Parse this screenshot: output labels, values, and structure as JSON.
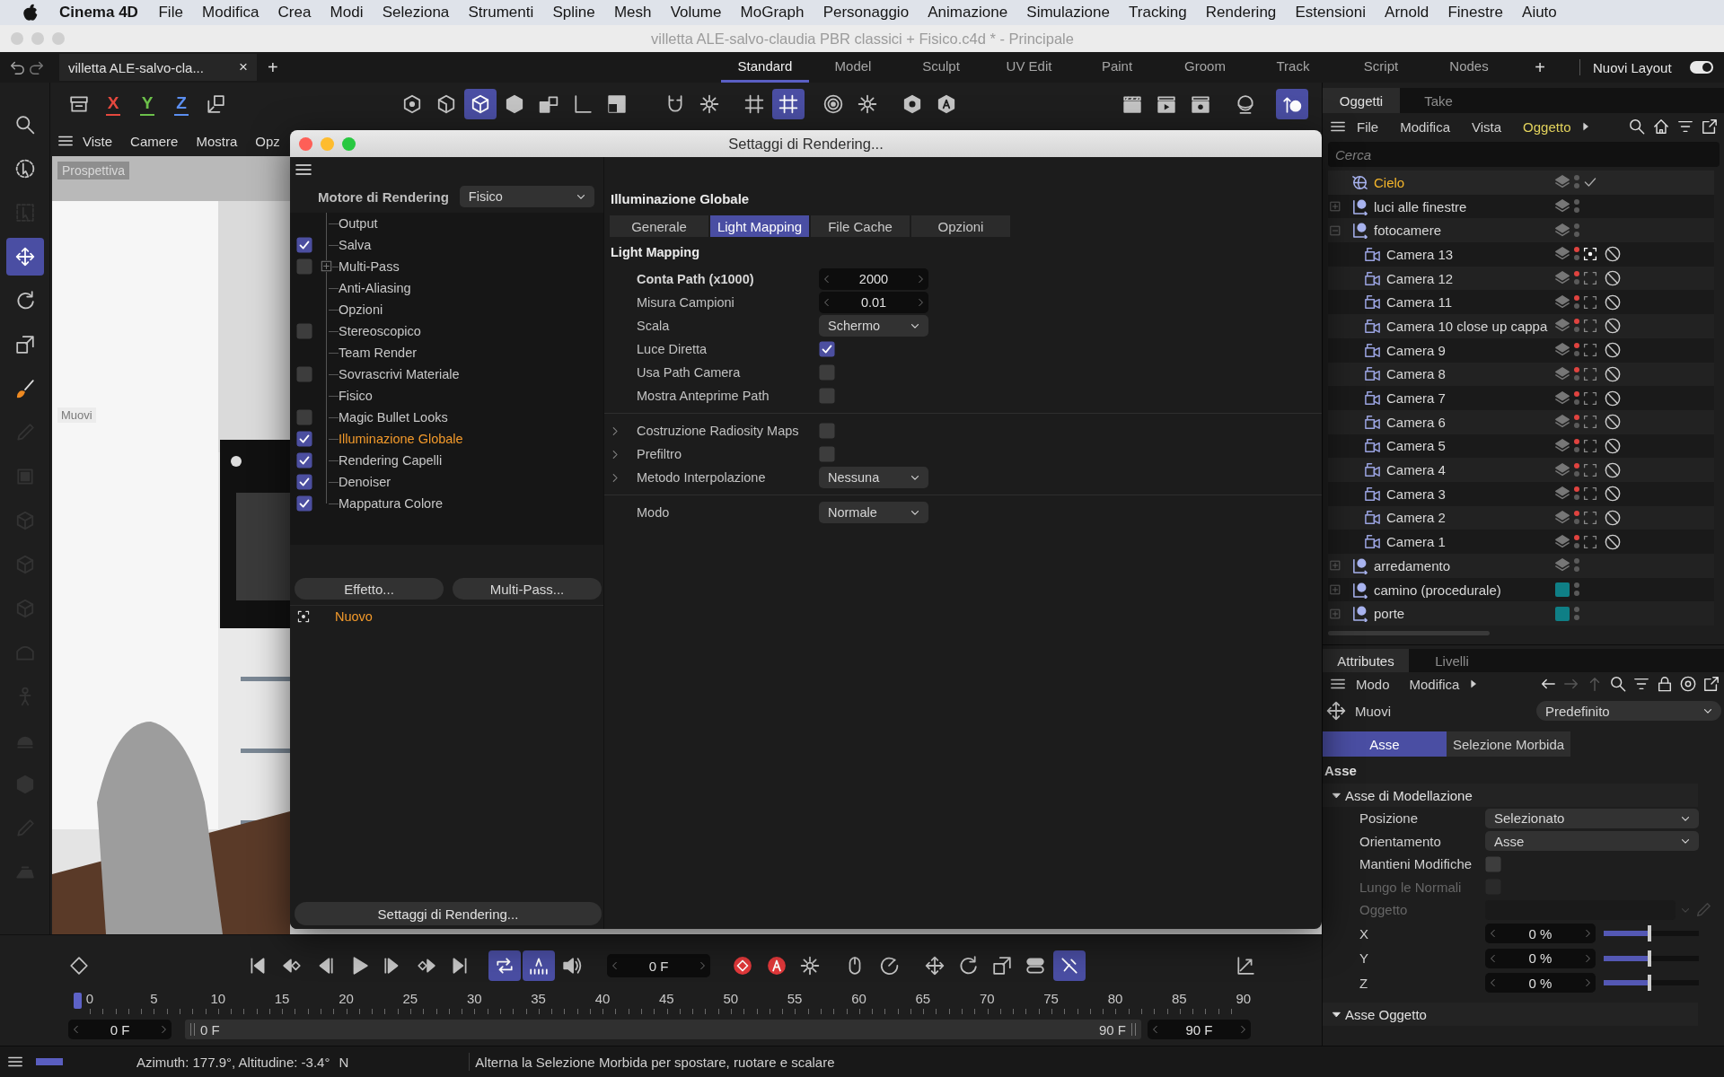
{
  "menu_bar": {
    "app": "Cinema 4D",
    "items": [
      "File",
      "Modifica",
      "Crea",
      "Modi",
      "Seleziona",
      "Strumenti",
      "Spline",
      "Mesh",
      "Volume",
      "MoGraph",
      "Personaggio",
      "Animazione",
      "Simulazione",
      "Tracking",
      "Rendering",
      "Estensioni",
      "Arnold",
      "Finestre",
      "Aiuto"
    ]
  },
  "window": {
    "title": "villetta ALE-salvo-claudia PBR classici + Fisico.c4d * - Principale"
  },
  "document_tab": {
    "title": "villetta ALE-salvo-cla...",
    "close": "×",
    "add": "+"
  },
  "layouts": [
    {
      "label": "Standard",
      "selected": true
    },
    {
      "label": "Model",
      "selected": false
    },
    {
      "label": "Sculpt",
      "selected": false
    },
    {
      "label": "UV Edit",
      "selected": false
    },
    {
      "label": "Paint",
      "selected": false
    },
    {
      "label": "Groom",
      "selected": false
    },
    {
      "label": "Track",
      "selected": false
    },
    {
      "label": "Script",
      "selected": false
    },
    {
      "label": "Nodes",
      "selected": false
    }
  ],
  "layout_add": "+",
  "layout_switch": {
    "label": "Nuovi Layout",
    "on": true
  },
  "toolbar": [
    [
      {
        "kind": "tray",
        "active": false
      },
      {
        "kind": "axis",
        "label": "X",
        "color": "#e5483e",
        "active": false
      },
      {
        "kind": "axis",
        "label": "Y",
        "color": "#6cc04a",
        "active": false
      },
      {
        "kind": "axis",
        "label": "Z",
        "color": "#5b8ef0",
        "active": false
      },
      {
        "kind": "axisbox",
        "active": false
      }
    ],
    [
      {
        "kind": "hexdot",
        "active": false
      },
      {
        "kind": "hexedge",
        "active": false
      },
      {
        "kind": "cube",
        "active": true
      },
      {
        "kind": "cubesolid",
        "active": false
      },
      {
        "kind": "cubes",
        "active": false
      },
      {
        "kind": "corner",
        "active": false
      },
      {
        "kind": "halfsquare",
        "active": false
      }
    ],
    [
      {
        "kind": "magnet",
        "active": false
      },
      {
        "kind": "gear",
        "active": false
      }
    ],
    [
      {
        "kind": "grid",
        "active": false
      },
      {
        "kind": "grid",
        "active": true
      }
    ],
    [
      {
        "kind": "rings",
        "active": false
      },
      {
        "kind": "gear",
        "active": false
      }
    ],
    [
      {
        "kind": "hexring",
        "active": false
      },
      {
        "kind": "hexa",
        "active": false
      }
    ],
    [
      {
        "kind": "clapper",
        "active": false
      },
      {
        "kind": "clapperplay",
        "active": false
      },
      {
        "kind": "clappergear",
        "active": false
      }
    ],
    [
      {
        "kind": "sphere",
        "active": false
      }
    ],
    [
      {
        "kind": "pin",
        "active": true
      }
    ]
  ],
  "tools": [
    {
      "kind": "search",
      "active": false,
      "disabled": false
    },
    {
      "kind": "select",
      "active": false,
      "disabled": false
    },
    {
      "kind": "boxselect",
      "active": false,
      "disabled": true
    },
    {
      "kind": "move",
      "active": true,
      "disabled": false
    },
    {
      "kind": "rotate",
      "active": false,
      "disabled": false
    },
    {
      "kind": "scale",
      "active": false,
      "disabled": false
    },
    {
      "kind": "brush",
      "active": false,
      "disabled": false
    },
    {
      "kind": "pen",
      "active": false,
      "disabled": true
    },
    {
      "kind": "square",
      "active": false,
      "disabled": true
    },
    {
      "kind": "cube",
      "active": false,
      "disabled": true
    },
    {
      "kind": "cube",
      "active": false,
      "disabled": true
    },
    {
      "kind": "cube",
      "active": false,
      "disabled": true
    },
    {
      "kind": "arc",
      "active": false,
      "disabled": true
    },
    {
      "kind": "figure",
      "active": false,
      "disabled": true
    },
    {
      "kind": "helmet",
      "active": false,
      "disabled": true
    },
    {
      "kind": "cubesolid",
      "active": false,
      "disabled": true
    },
    {
      "kind": "pen",
      "active": false,
      "disabled": true
    },
    {
      "kind": "iron",
      "active": false,
      "disabled": true
    }
  ],
  "viewport": {
    "menu": [
      "Viste",
      "Camere",
      "Mostra",
      "Opz"
    ],
    "camera": "Prospettiva",
    "tool_hint": "Muovi"
  },
  "render_settings": {
    "title": "Settaggi di Rendering...",
    "renderer_label": "Motore di Rendering",
    "renderer": "Fisico",
    "pages": [
      {
        "label": "Output",
        "kind": "plain",
        "selected": false
      },
      {
        "label": "Salva",
        "kind": "checkbox",
        "checked": true,
        "selected": false
      },
      {
        "label": "Multi-Pass",
        "kind": "checkbox",
        "checked": false,
        "expanded": false,
        "selected": false
      },
      {
        "label": "Anti-Aliasing",
        "kind": "plain",
        "selected": false
      },
      {
        "label": "Opzioni",
        "kind": "plain",
        "selected": false
      },
      {
        "label": "Stereoscopico",
        "kind": "checkbox",
        "checked": false,
        "selected": false
      },
      {
        "label": "Team Render",
        "kind": "plain",
        "selected": false
      },
      {
        "label": "Sovrascrivi Materiale",
        "kind": "checkbox",
        "checked": false,
        "selected": false
      },
      {
        "label": "Fisico",
        "kind": "plain",
        "selected": false
      },
      {
        "label": "Magic Bullet Looks",
        "kind": "checkbox",
        "checked": false,
        "selected": false
      },
      {
        "label": "Illuminazione Globale",
        "kind": "checkbox",
        "checked": true,
        "selected": true
      },
      {
        "label": "Rendering Capelli",
        "kind": "checkbox",
        "checked": true,
        "selected": false
      },
      {
        "label": "Denoiser",
        "kind": "checkbox",
        "checked": true,
        "selected": false
      },
      {
        "label": "Mappatura Colore",
        "kind": "checkbox",
        "checked": true,
        "selected": false
      }
    ],
    "buttons": [
      "Effetto...",
      "Multi-Pass..."
    ],
    "presets": [
      {
        "label": "Nuovo",
        "selected": true
      }
    ],
    "preset_button": "Settaggi di Rendering...",
    "panel": {
      "title": "Illuminazione Globale",
      "tabs": [
        {
          "label": "Generale",
          "selected": false
        },
        {
          "label": "Light Mapping",
          "selected": true
        },
        {
          "label": "File Cache",
          "selected": false
        },
        {
          "label": "Opzioni",
          "selected": false
        }
      ],
      "section": "Light Mapping",
      "groups": [
        [
          {
            "label": "Conta Path (x1000)",
            "kind": "number",
            "value": "2000",
            "modified": true
          },
          {
            "label": "Misura Campioni",
            "kind": "number",
            "value": "0.01",
            "modified": false
          },
          {
            "label": "Scala",
            "kind": "dropdown",
            "value": "Schermo",
            "modified": false
          },
          {
            "label": "Luce Diretta",
            "kind": "checkbox",
            "checked": true,
            "modified": false
          },
          {
            "label": "Usa Path Camera",
            "kind": "checkbox",
            "checked": false,
            "modified": false
          },
          {
            "label": "Mostra Anteprime Path",
            "kind": "checkbox",
            "checked": false,
            "modified": false
          }
        ],
        [
          {
            "label": "Costruzione Radiosity Maps",
            "kind": "checkbox",
            "checked": false,
            "expanded": false,
            "modified": false
          },
          {
            "label": "Prefiltro",
            "kind": "checkbox",
            "checked": false,
            "expanded": false,
            "modified": false
          },
          {
            "label": "Metodo Interpolazione",
            "kind": "dropdown",
            "value": "Nessuna",
            "expanded": false,
            "modified": false
          }
        ],
        [
          {
            "label": "Modo",
            "kind": "dropdown",
            "value": "Normale",
            "modified": false
          }
        ]
      ]
    }
  },
  "objects": {
    "tabs": [
      {
        "label": "Oggetti",
        "selected": true
      },
      {
        "label": "Take",
        "selected": false
      }
    ],
    "menu": [
      {
        "label": "File",
        "selected": false
      },
      {
        "label": "Modifica",
        "selected": false
      },
      {
        "label": "Vista",
        "selected": false
      },
      {
        "label": "Oggetto",
        "selected": true
      }
    ],
    "search": {
      "placeholder": "Cerca"
    },
    "items": [
      {
        "name": "Cielo",
        "kind": "sky",
        "selected": true,
        "editor_visible": true,
        "marks": [
          {
            "kind": "check"
          }
        ]
      },
      {
        "name": "luci alle finestre",
        "kind": "null",
        "selected": false,
        "expanded": false,
        "editor_visible": true
      },
      {
        "name": "fotocamere",
        "kind": "null",
        "selected": false,
        "expanded": true,
        "editor_visible": true,
        "children": [
          {
            "name": "Camera 13",
            "kind": "camera",
            "selected": false,
            "editor_visible": false,
            "marks": [
              {
                "kind": "bracket-active"
              },
              {
                "kind": "prohibit"
              }
            ]
          },
          {
            "name": "Camera 12",
            "kind": "camera",
            "selected": false,
            "editor_visible": false,
            "marks": [
              {
                "kind": "bracket"
              },
              {
                "kind": "prohibit"
              }
            ]
          },
          {
            "name": "Camera 11",
            "kind": "camera",
            "selected": false,
            "editor_visible": false,
            "marks": [
              {
                "kind": "bracket"
              },
              {
                "kind": "prohibit"
              }
            ]
          },
          {
            "name": "Camera 10 close up cappa",
            "kind": "camera",
            "selected": false,
            "editor_visible": false,
            "marks": [
              {
                "kind": "bracket"
              },
              {
                "kind": "prohibit"
              }
            ]
          },
          {
            "name": "Camera 9",
            "kind": "camera",
            "selected": false,
            "editor_visible": false,
            "marks": [
              {
                "kind": "bracket"
              },
              {
                "kind": "prohibit"
              }
            ]
          },
          {
            "name": "Camera 8",
            "kind": "camera",
            "selected": false,
            "editor_visible": false,
            "marks": [
              {
                "kind": "bracket"
              },
              {
                "kind": "prohibit"
              }
            ]
          },
          {
            "name": "Camera 7",
            "kind": "camera",
            "selected": false,
            "editor_visible": false,
            "marks": [
              {
                "kind": "bracket"
              },
              {
                "kind": "prohibit"
              }
            ]
          },
          {
            "name": "Camera 6",
            "kind": "camera",
            "selected": false,
            "editor_visible": false,
            "marks": [
              {
                "kind": "bracket"
              },
              {
                "kind": "prohibit"
              }
            ]
          },
          {
            "name": "Camera 5",
            "kind": "camera",
            "selected": false,
            "editor_visible": false,
            "marks": [
              {
                "kind": "bracket"
              },
              {
                "kind": "prohibit"
              }
            ]
          },
          {
            "name": "Camera 4",
            "kind": "camera",
            "selected": false,
            "editor_visible": false,
            "marks": [
              {
                "kind": "bracket"
              },
              {
                "kind": "prohibit"
              }
            ]
          },
          {
            "name": "Camera 3",
            "kind": "camera",
            "selected": false,
            "editor_visible": false,
            "marks": [
              {
                "kind": "bracket"
              },
              {
                "kind": "prohibit"
              }
            ]
          },
          {
            "name": "Camera 2",
            "kind": "camera",
            "selected": false,
            "editor_visible": false,
            "marks": [
              {
                "kind": "bracket"
              },
              {
                "kind": "prohibit"
              }
            ]
          },
          {
            "name": "Camera 1",
            "kind": "camera",
            "selected": false,
            "editor_visible": false,
            "marks": [
              {
                "kind": "bracket"
              },
              {
                "kind": "prohibit"
              }
            ]
          }
        ]
      },
      {
        "name": "arredamento",
        "kind": "null",
        "selected": false,
        "expanded": false,
        "editor_visible": true
      },
      {
        "name": "camino (procedurale)",
        "kind": "null",
        "selected": false,
        "expanded": false,
        "editor_visible": true,
        "color": "#0f7f86"
      },
      {
        "name": "porte",
        "kind": "null",
        "selected": false,
        "expanded": false,
        "editor_visible": true,
        "color": "#0f7f86"
      }
    ]
  },
  "attributes": {
    "tabs": [
      {
        "label": "Attributes",
        "selected": true
      },
      {
        "label": "Livelli",
        "selected": false
      }
    ],
    "menu": [
      "Modo",
      "Modifica"
    ],
    "tools": [
      {
        "kind": "back",
        "disabled": false
      },
      {
        "kind": "forward",
        "disabled": true
      },
      {
        "kind": "up",
        "disabled": true
      },
      {
        "kind": "search",
        "disabled": false
      },
      {
        "kind": "filter",
        "disabled": false
      },
      {
        "kind": "lock",
        "disabled": false
      },
      {
        "kind": "target",
        "disabled": false
      },
      {
        "kind": "external",
        "disabled": false
      }
    ],
    "mode_label": "Muovi",
    "preset": "Predefinito",
    "subtabs": [
      {
        "label": "Asse",
        "selected": true
      },
      {
        "label": "Selezione Morbida",
        "selected": false
      }
    ],
    "section": "Asse",
    "groups": [
      {
        "title": "Asse di Modellazione",
        "expanded": true,
        "params": [
          {
            "label": "Posizione",
            "kind": "dropdown",
            "value": "Selezionato",
            "disabled": false
          },
          {
            "label": "Orientamento",
            "kind": "dropdown",
            "value": "Asse",
            "disabled": false
          },
          {
            "label": "Mantieni Modifiche",
            "kind": "checkbox",
            "checked": false,
            "disabled": false
          },
          {
            "label": "Lungo le Normali",
            "kind": "checkbox",
            "checked": false,
            "disabled": true
          },
          {
            "label": "Oggetto",
            "kind": "link",
            "disabled": true
          },
          {
            "label": "X",
            "kind": "percent",
            "value": "0 %",
            "level": 0.5,
            "disabled": false
          },
          {
            "label": "Y",
            "kind": "percent",
            "value": "0 %",
            "level": 0.5,
            "disabled": false
          },
          {
            "label": "Z",
            "kind": "percent",
            "value": "0 %",
            "level": 0.5,
            "disabled": false
          }
        ]
      },
      {
        "title": "Asse Oggetto",
        "expanded": true
      }
    ]
  },
  "timeline": {
    "groups": [
      [
        {
          "kind": "key",
          "active": false
        }
      ],
      [
        {
          "kind": "first",
          "active": false
        },
        {
          "kind": "prevkey",
          "active": false
        },
        {
          "kind": "prevframe",
          "active": false
        },
        {
          "kind": "play",
          "active": false
        },
        {
          "kind": "nextframe",
          "active": false
        },
        {
          "kind": "nextkey",
          "active": false
        },
        {
          "kind": "last",
          "active": false
        }
      ],
      [
        {
          "kind": "loop",
          "active": true
        },
        {
          "kind": "bars",
          "active": true
        },
        {
          "kind": "speaker",
          "active": false
        }
      ],
      [
        {
          "kind": "record",
          "active": false
        },
        {
          "kind": "autokey",
          "active": false
        },
        {
          "kind": "gear",
          "active": false
        }
      ],
      [
        {
          "kind": "mouse",
          "active": false
        },
        {
          "kind": "dial",
          "active": false
        }
      ],
      [
        {
          "kind": "move",
          "active": false
        },
        {
          "kind": "rotate",
          "active": false
        },
        {
          "kind": "scale",
          "active": false
        },
        {
          "kind": "toggle",
          "active": false
        },
        {
          "kind": "strike",
          "active": true
        }
      ],
      [
        {
          "kind": "graph",
          "active": false
        }
      ]
    ],
    "frame": "0 F",
    "ruler": [
      "0",
      "5",
      "10",
      "15",
      "20",
      "25",
      "30",
      "35",
      "40",
      "45",
      "50",
      "55",
      "60",
      "65",
      "70",
      "75",
      "80",
      "85",
      "90"
    ],
    "playhead": {
      "level": 0
    },
    "range": {
      "start": "0 F",
      "bar_start": "0 F",
      "bar_end": "90 F",
      "end": "90 F"
    }
  },
  "status_bar": {
    "readout": "Azimuth: 177.9°, Altitudine: -3.4°",
    "compass": "N",
    "hint": "Alterna la Selezione Morbida per spostare, ruotare e scalare"
  }
}
